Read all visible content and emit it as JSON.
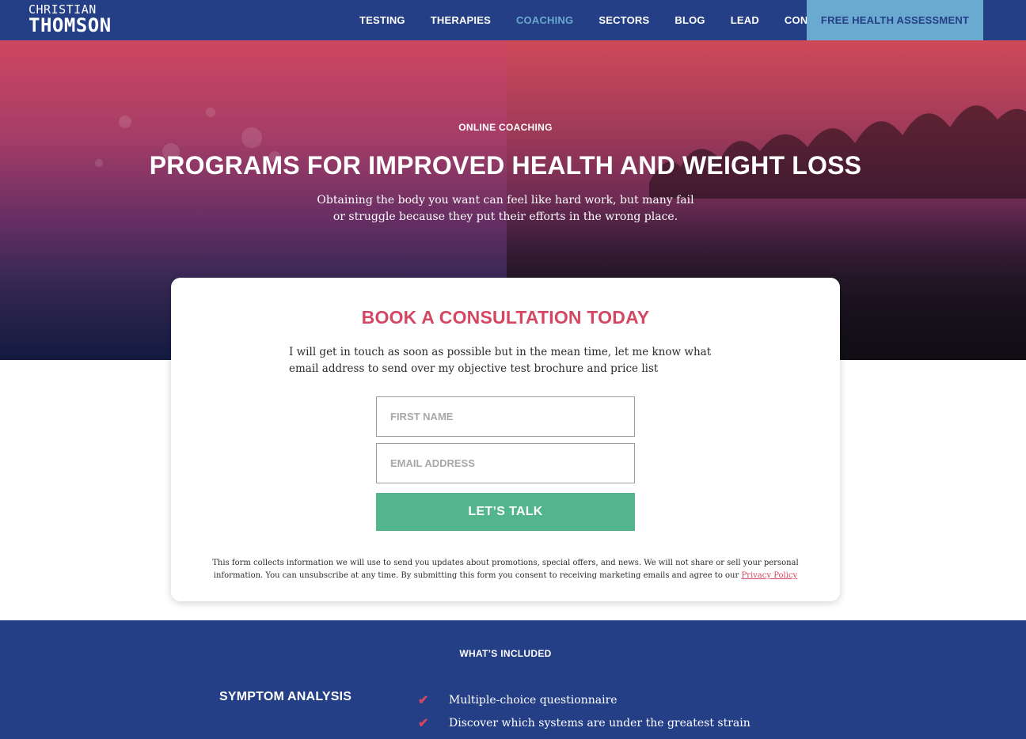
{
  "nav": {
    "logo_first": "CHRISTIAN",
    "logo_last": "THOMSON",
    "links": [
      {
        "label": "TESTING"
      },
      {
        "label": "THERAPIES"
      },
      {
        "label": "COACHING"
      },
      {
        "label": "SECTORS"
      },
      {
        "label": "BLOG"
      },
      {
        "label": "LEAD"
      },
      {
        "label": "CONTACT"
      }
    ],
    "active_link": "COACHING",
    "cta_label": "FREE HEALTH ASSESSMENT"
  },
  "hero": {
    "eyebrow": "ONLINE COACHING",
    "title": "PROGRAMS FOR IMPROVED HEALTH AND WEIGHT LOSS",
    "subtitle": "Obtaining the body you want can feel like hard work, but many fail or struggle because they put their efforts in the wrong place."
  },
  "consultation": {
    "title": "BOOK A CONSULTATION TODAY",
    "text": "I will get in touch as soon as possible but in the mean time, let me know what email address to send over my objective test brochure and price list",
    "first_name_placeholder": "FIRST NAME",
    "email_placeholder": "EMAIL ADDRESS",
    "submit_label": "LET’S TALK",
    "fine_print": "This form collects information we will use to send you updates about promotions, special offers, and news. We will not share or sell your personal information. You can unsubscribe at any time. By submitting this form you consent to receiving marketing emails and agree to our ",
    "privacy_link": "Privacy Policy"
  },
  "included": {
    "title": "WHAT’S INCLUDED",
    "heading": "SYMPTOM ANALYSIS",
    "items": [
      {
        "text": "Multiple-choice questionnaire"
      },
      {
        "text": "Discover which systems are under the greatest strain"
      }
    ]
  },
  "colors": {
    "nav_bg": "#243f86",
    "accent_blue": "#6aaad0",
    "accent_red": "#d44763",
    "button_green": "#52b58c"
  }
}
